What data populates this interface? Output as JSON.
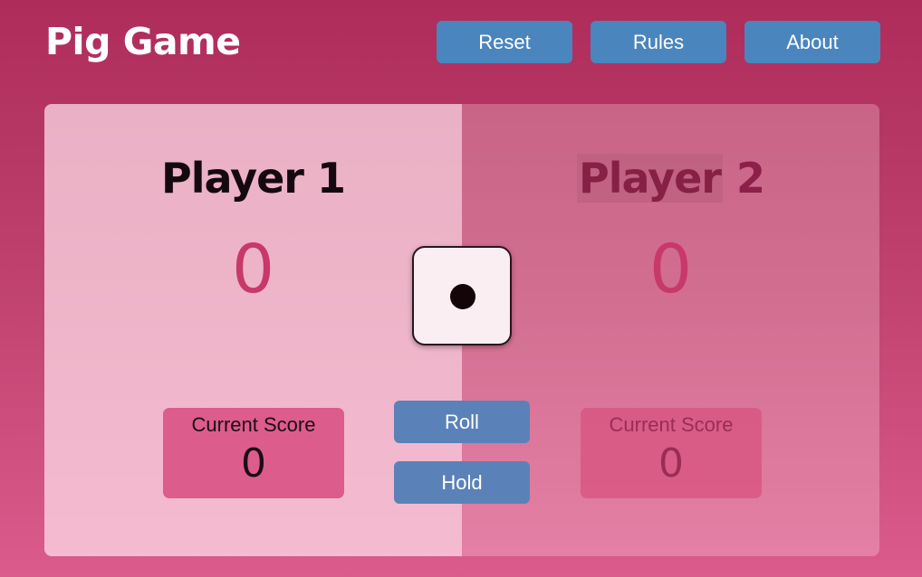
{
  "header": {
    "title": "Pig Game",
    "buttons": {
      "reset": "Reset",
      "rules": "Rules",
      "about": "About"
    }
  },
  "players": [
    {
      "name": "Player 1",
      "total_score": "0",
      "current_label": "Current Score",
      "current_score": "0",
      "active": true
    },
    {
      "name_part_1": "Player",
      "name_part_2": " 2",
      "total_score": "0",
      "current_label": "Current Score",
      "current_score": "0",
      "active": false
    }
  ],
  "dice": {
    "value": 1,
    "icon": "dice-one-icon"
  },
  "controls": {
    "roll": "Roll",
    "hold": "Hold"
  },
  "colors": {
    "accent_button": "#4b85bd",
    "score_text": "#c8386a",
    "background": "#c0426e"
  }
}
